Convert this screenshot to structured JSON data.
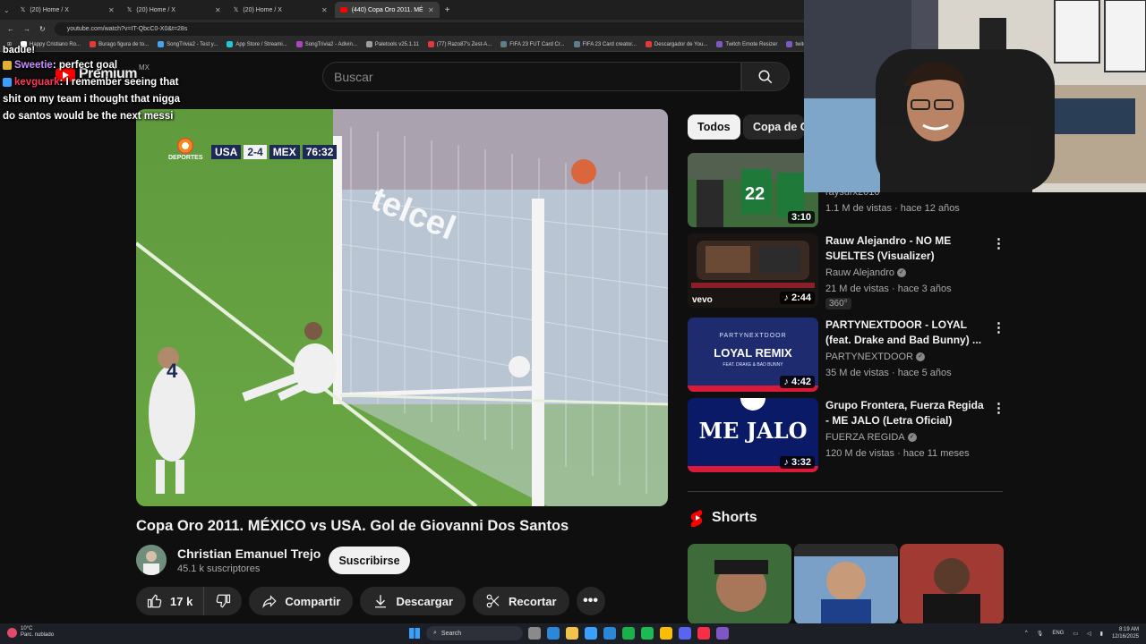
{
  "browser": {
    "tabs": [
      {
        "label": "(20) Home / X",
        "active": false
      },
      {
        "label": "(20) Home / X",
        "active": false
      },
      {
        "label": "(20) Home / X",
        "active": false
      },
      {
        "label": "(440) Copa Oro 2011. MÉ",
        "active": true
      }
    ],
    "new_tab_label": "+",
    "url": "youtube.com/watch?v=IT-QbcC0-X0&t=28s",
    "bookmarks": [
      {
        "label": "Happy Cristiano Ro...",
        "color": "#ffffff"
      },
      {
        "label": "Burago figura de to...",
        "color": "#e53935"
      },
      {
        "label": "SongTrivia2 - Test y...",
        "color": "#42a5f5"
      },
      {
        "label": "App Store / Streami...",
        "color": "#26c6da"
      },
      {
        "label": "SongTrivia2 - Adivin...",
        "color": "#ab47bc"
      },
      {
        "label": "Paletools v25.1.11",
        "color": "#9e9e9e"
      },
      {
        "label": "(77) Razo87's Zest-A...",
        "color": "#e53935"
      },
      {
        "label": "FIFA 23 FUT Card Cr...",
        "color": "#607d8b"
      },
      {
        "label": "FIFA 23 Card creator...",
        "color": "#607d8b"
      },
      {
        "label": "Descargador de You...",
        "color": "#e53935"
      },
      {
        "label": "Twitch Emote Resizer",
        "color": "#7e57c2"
      },
      {
        "label": "twitch em",
        "color": "#7e57c2"
      }
    ]
  },
  "youtube": {
    "logo": "Premium",
    "country": "MX",
    "search_placeholder": "Buscar",
    "video": {
      "title": "Copa Oro 2011. MÉXICO vs USA. Gol de Giovanni Dos Santos",
      "network": "DEPORTES",
      "scoreboard": {
        "home": "USA",
        "score": "2-4",
        "away": "MEX",
        "clock": "76:32"
      },
      "channel": "Christian Emanuel Trejo",
      "subscribers": "45.1 k suscriptores",
      "subscribe_label": "Suscribirse",
      "likes": "17 k",
      "share_label": "Compartir",
      "download_label": "Descargar",
      "clip_label": "Recortar",
      "more_label": "•••"
    },
    "chips": [
      "Todos",
      "Copa de O"
    ],
    "recommendations": [
      {
        "title": "",
        "channel": "raysurx2010",
        "meta": "1.1 M de vistas · hace 12 años",
        "duration": "3:10",
        "tag": "",
        "verified": false
      },
      {
        "title": "Rauw Alejandro - NO ME SUELTES (Visualizer)",
        "channel": "Rauw Alejandro",
        "meta": "21 M de vistas · hace 3 años",
        "duration": "2:44",
        "tag": "360°",
        "verified": true
      },
      {
        "title": "PARTYNEXTDOOR - LOYAL (feat. Drake and Bad Bunny) ...",
        "channel": "PARTYNEXTDOOR",
        "meta": "35 M de vistas · hace 5 años",
        "duration": "4:42",
        "tag": "",
        "verified": true,
        "thumb_text": "LOYAL REMIX",
        "thumb_sub": "PARTYNEXTDOOR",
        "thumb_feat": "FEAT. DRAKE & BAD BUNNY"
      },
      {
        "title": "Grupo Frontera, Fuerza Regida - ME JALO (Letra Oficial)",
        "channel": "FUERZA REGIDA",
        "meta": "120 M de vistas · hace 11 meses",
        "duration": "3:32",
        "tag": "",
        "verified": true,
        "thumb_text": "ME JALO"
      }
    ],
    "thumb_vevo": "vevo",
    "shorts_label": "Shorts"
  },
  "chat": {
    "cut_line": "badue!",
    "messages": [
      {
        "user": "Sweetie",
        "text": ": perfect goal",
        "badge_color": "#e0b030",
        "user_color": "#c88cff"
      },
      {
        "user": "kevguark",
        "text": ": I remember seeing that shit on my team i thought that nigga do santos would be the next messi",
        "badge_color": "#3aa0ff",
        "user_color": "#ff3355"
      }
    ]
  },
  "taskbar": {
    "temperature": "10°C",
    "weather": "Parc. nublado",
    "search": "Search",
    "lang": "ENG",
    "time": "8:19 AM",
    "date": "12/16/2025"
  }
}
